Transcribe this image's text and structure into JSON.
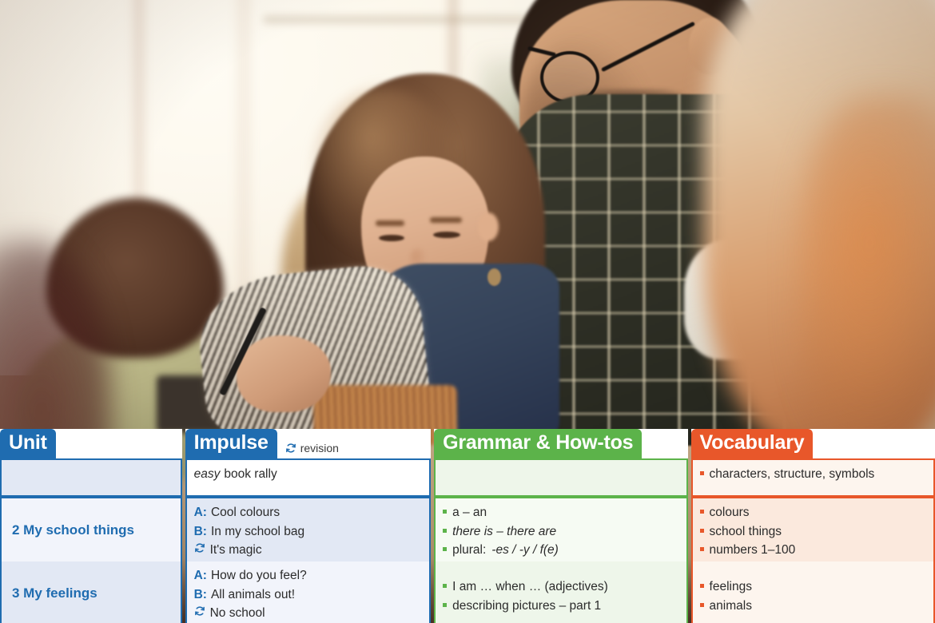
{
  "photo": {
    "alt": "classroom-photo-teacher-helping-student",
    "description": "A teacher with glasses and a dark plaid shirt leans over to help a young girl in denim overalls writing with a pencil in a bright classroom"
  },
  "colors": {
    "blue": "#1f6cb0",
    "green": "#5cb34a",
    "orange": "#e8572a",
    "blue_tint": "#e2e8f4",
    "green_tint": "#eef6ea",
    "orange_tint": "#fbe9dd"
  },
  "table": {
    "columns": [
      {
        "key": "unit",
        "tab_label": "Unit",
        "accent": "#1f6cb0",
        "rows": [
          {
            "label": ""
          },
          {
            "label": "2 My school things"
          },
          {
            "label": "3 My feelings"
          }
        ]
      },
      {
        "key": "impulse",
        "tab_label": "Impulse",
        "accent": "#1f6cb0",
        "revision_label": "revision",
        "revision_icon": "cycle-revision-icon",
        "rows": [
          {
            "lines": [
              {
                "em": "easy",
                "text": "book rally"
              }
            ]
          },
          {
            "lines": [
              {
                "speaker": "A:",
                "text": "Cool colours"
              },
              {
                "speaker": "B:",
                "text": "In my school bag"
              },
              {
                "icon": "cycle-revision-icon",
                "text": "It's magic"
              }
            ]
          },
          {
            "lines": [
              {
                "speaker": "A:",
                "text": "How do you feel?"
              },
              {
                "speaker": "B:",
                "text": "All animals out!"
              },
              {
                "icon": "cycle-revision-icon",
                "text": "No school"
              }
            ]
          }
        ]
      },
      {
        "key": "grammar",
        "tab_label": "Grammar & How-tos",
        "accent": "#5cb34a",
        "rows": [
          {
            "items": []
          },
          {
            "items": [
              {
                "text": "a – an"
              },
              {
                "text": "there is – there are",
                "italic": true
              },
              {
                "text": "plural: ",
                "italic_tail": "-es / -y / f(e)"
              }
            ]
          },
          {
            "items": [
              {
                "text": "I am … when … (adjectives)"
              },
              {
                "text": "describing pictures – part 1"
              }
            ]
          }
        ]
      },
      {
        "key": "vocabulary",
        "tab_label": "Vocabulary",
        "accent": "#e8572a",
        "rows": [
          {
            "items": [
              {
                "text": "characters, structure, symbols"
              }
            ]
          },
          {
            "items": [
              {
                "text": "colours"
              },
              {
                "text": "school things"
              },
              {
                "text": "numbers 1–100"
              }
            ]
          },
          {
            "items": [
              {
                "text": "feelings"
              },
              {
                "text": "animals"
              }
            ]
          }
        ]
      }
    ]
  }
}
